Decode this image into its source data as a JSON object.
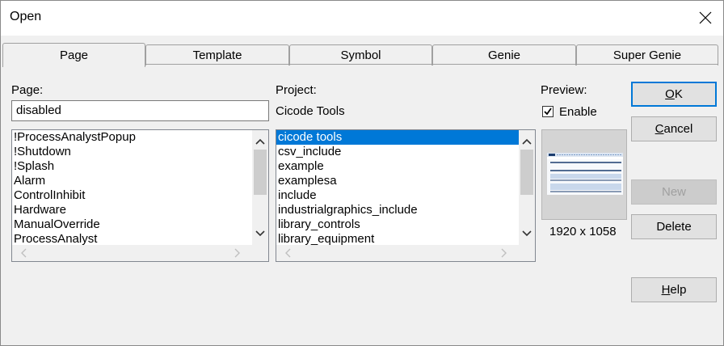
{
  "window": {
    "title": "Open"
  },
  "tabs": [
    {
      "label": "Page",
      "active": true
    },
    {
      "label": "Template",
      "active": false
    },
    {
      "label": "Symbol",
      "active": false
    },
    {
      "label": "Genie",
      "active": false
    },
    {
      "label": "Super Genie",
      "active": false
    }
  ],
  "page": {
    "label": "Page:",
    "value": "disabled",
    "items": [
      "!ProcessAnalystPopup",
      "!Shutdown",
      "!Splash",
      "Alarm",
      "ControlInhibit",
      "Hardware",
      "ManualOverride",
      "ProcessAnalyst"
    ]
  },
  "project": {
    "label": "Project:",
    "current": "Cicode Tools",
    "items": [
      "cicode tools",
      "csv_include",
      "example",
      "examplesa",
      "include",
      "industrialgraphics_include",
      "library_controls",
      "library_equipment"
    ],
    "selected_index": 0
  },
  "preview": {
    "label": "Preview:",
    "enable_label": "Enable",
    "enabled": true,
    "resolution": "1920 x 1058"
  },
  "buttons": {
    "ok": {
      "mnemonic": "O",
      "rest": "K"
    },
    "cancel": {
      "mnemonic": "C",
      "rest": "ancel"
    },
    "new": "New",
    "delete": "Delete",
    "help": {
      "mnemonic": "H",
      "rest": "elp"
    }
  },
  "colors": {
    "selection": "#0078d7",
    "default_button_border": "#0078d7",
    "preview_accent": "#1c3d6e"
  }
}
